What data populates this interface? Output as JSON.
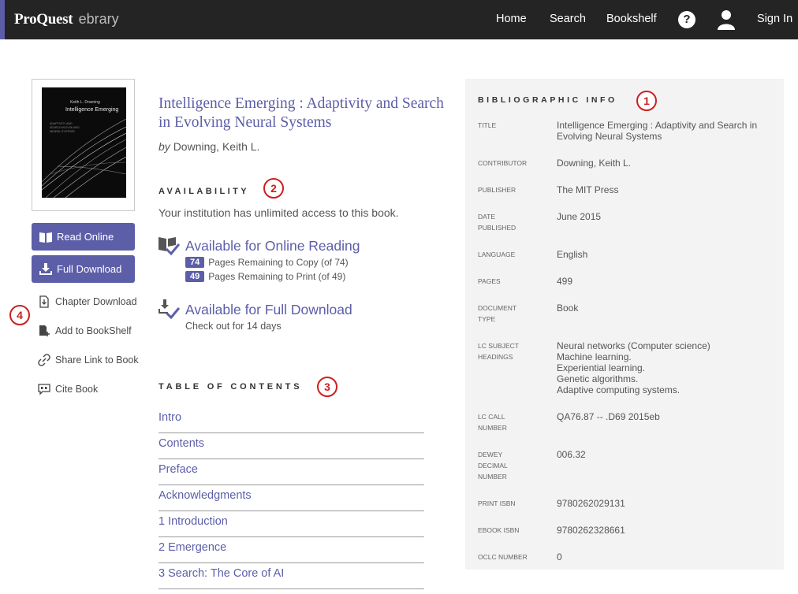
{
  "header": {
    "brand_main": "ProQuest",
    "brand_sub": "ebrary",
    "nav": {
      "home": "Home",
      "search": "Search",
      "bookshelf": "Bookshelf",
      "help": "?",
      "sign_in": "Sign In"
    }
  },
  "cover": {
    "author": "Keith L. Downing",
    "title": "Intelligence Emerging",
    "subtitle": "ADAPTIVITY AND SEARCH IN EVOLVING NEURAL SYSTEMS"
  },
  "actions": {
    "read_online": "Read Online",
    "full_download": "Full Download",
    "chapter_download": "Chapter Download",
    "add_to_bookshelf": "Add to BookShelf",
    "share_link": "Share Link to Book",
    "cite_book": "Cite Book"
  },
  "book": {
    "title": "Intelligence Emerging : Adaptivity and Search in Evolving Neural Systems",
    "by": "by",
    "author": "Downing, Keith L."
  },
  "availability": {
    "heading": "AVAILABILITY",
    "access": "Your institution has unlimited access to this book.",
    "online_title": "Available for Online Reading",
    "copy_count": "74",
    "copy_text": "Pages Remaining to Copy (of 74)",
    "print_count": "49",
    "print_text": "Pages Remaining to Print (of 49)",
    "download_title": "Available for Full Download",
    "checkout": "Check out for 14 days"
  },
  "toc": {
    "heading": "TABLE OF CONTENTS",
    "items": [
      "Intro",
      "Contents",
      "Preface",
      "Acknowledgments",
      "1 Introduction",
      "2 Emergence",
      "3 Search: The Core of AI"
    ]
  },
  "biblio": {
    "heading": "BIBLIOGRAPHIC INFO",
    "rows": [
      {
        "label": "TITLE",
        "value": "Intelligence Emerging : Adaptivity and Search in Evolving Neural Systems"
      },
      {
        "label": "CONTRIBUTOR",
        "value": "Downing, Keith L."
      },
      {
        "label": "PUBLISHER",
        "value": "The MIT Press"
      },
      {
        "label": "DATE PUBLISHED",
        "value": "June 2015"
      },
      {
        "label": "LANGUAGE",
        "value": "English"
      },
      {
        "label": "PAGES",
        "value": "499"
      },
      {
        "label": "DOCUMENT TYPE",
        "value": "Book"
      },
      {
        "label": "LC SUBJECT HEADINGS",
        "value": "Neural networks (Computer science)\nMachine learning.\nExperiential learning.\nGenetic algorithms.\nAdaptive computing systems."
      },
      {
        "label": "LC CALL NUMBER",
        "value": "QA76.87 -- .D69 2015eb"
      },
      {
        "label": "DEWEY DECIMAL NUMBER",
        "value": "006.32"
      },
      {
        "label": "PRINT ISBN",
        "value": "9780262029131"
      },
      {
        "label": "EBOOK ISBN",
        "value": "9780262328661"
      },
      {
        "label": "OCLC NUMBER",
        "value": "0"
      }
    ]
  },
  "markers": [
    "1",
    "2",
    "3",
    "4"
  ]
}
